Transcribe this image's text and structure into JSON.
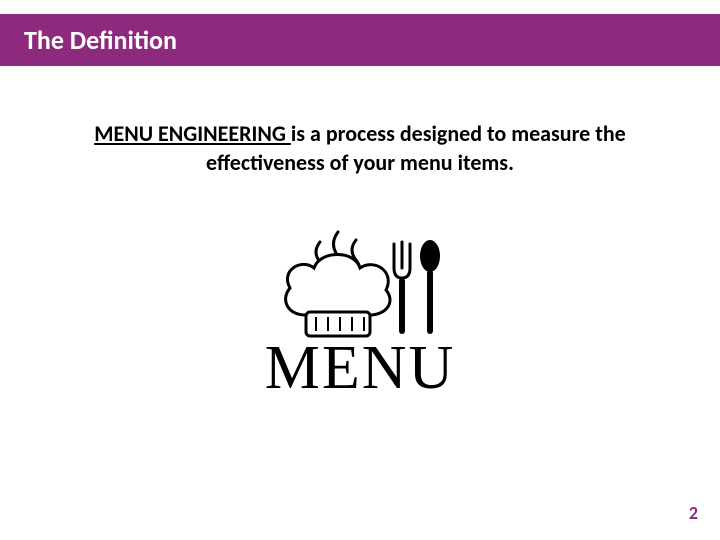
{
  "header": {
    "title": "The Definition"
  },
  "body": {
    "term": "MENU ENGINEERING ",
    "rest": "is a process designed to measure the effectiveness of your menu items."
  },
  "graphic": {
    "word": "MENU"
  },
  "page_number": "2",
  "colors": {
    "accent": "#8e2a7e"
  }
}
